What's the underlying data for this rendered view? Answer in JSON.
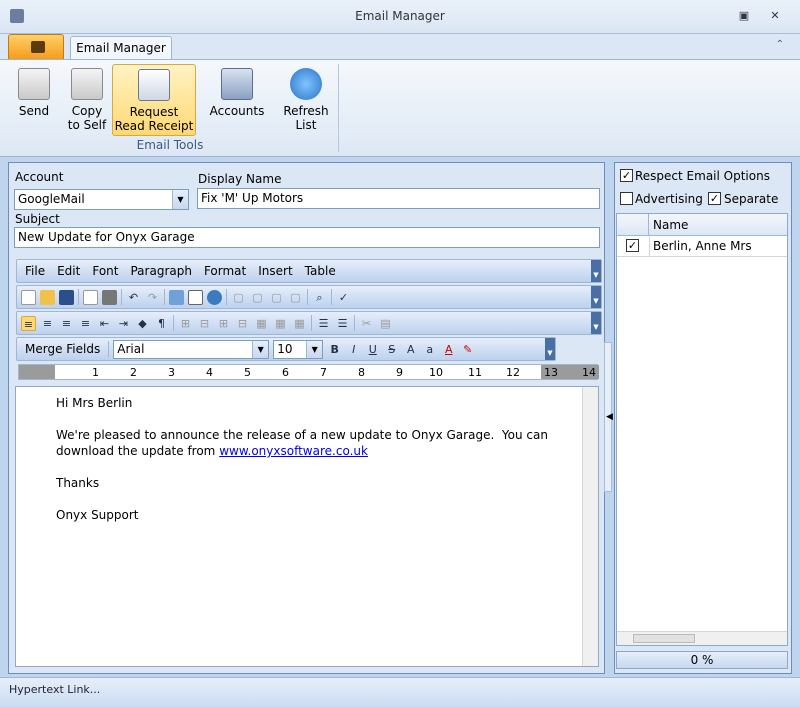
{
  "window": {
    "title": "Email Manager"
  },
  "ribbon": {
    "tab": "Email Manager",
    "group_label": "Email Tools",
    "buttons": [
      {
        "line1": "Send",
        "line2": "",
        "icon": "send-envelope-icon"
      },
      {
        "line1": "Copy",
        "line2": "to Self",
        "icon": "copy-envelope-icon"
      },
      {
        "line1": "Request",
        "line2": "Read Receipt",
        "icon": "read-receipt-icon"
      },
      {
        "line1": "Accounts",
        "line2": "",
        "icon": "accounts-icon"
      },
      {
        "line1": "Refresh",
        "line2": "List",
        "icon": "refresh-icon"
      }
    ]
  },
  "form": {
    "account_label": "Account",
    "account_value": "GoogleMail",
    "display_name_label": "Display Name",
    "display_name_value": "Fix 'M' Up Motors",
    "subject_label": "Subject",
    "subject_value": "New Update for Onyx Garage"
  },
  "editor": {
    "menu": [
      "File",
      "Edit",
      "Font",
      "Paragraph",
      "Format",
      "Insert",
      "Table"
    ],
    "merge_fields": "Merge Fields",
    "font": "Arial",
    "font_size": "10",
    "ruler_numbers": [
      "1",
      "2",
      "3",
      "4",
      "5",
      "6",
      "7",
      "8",
      "9",
      "10",
      "11",
      "12",
      "13",
      "14"
    ],
    "body": {
      "greeting": "Hi Mrs Berlin",
      "line1": "We're pleased to announce the release of a new update to Onyx Garage.  You can",
      "line2_prefix": "download the update from ",
      "link": "www.onyxsoftware.co.uk",
      "thanks": "Thanks",
      "signature": "Onyx Support"
    }
  },
  "options": {
    "respect": {
      "label": "Respect Email Options",
      "checked": true
    },
    "advertising": {
      "label": "Advertising",
      "checked": false
    },
    "separate": {
      "label": "Separate",
      "checked": true
    }
  },
  "recipients": {
    "column": "Name",
    "rows": [
      {
        "name": "Berlin, Anne Mrs",
        "checked": true
      }
    ]
  },
  "progress": "0 %",
  "status": "Hypertext Link..."
}
